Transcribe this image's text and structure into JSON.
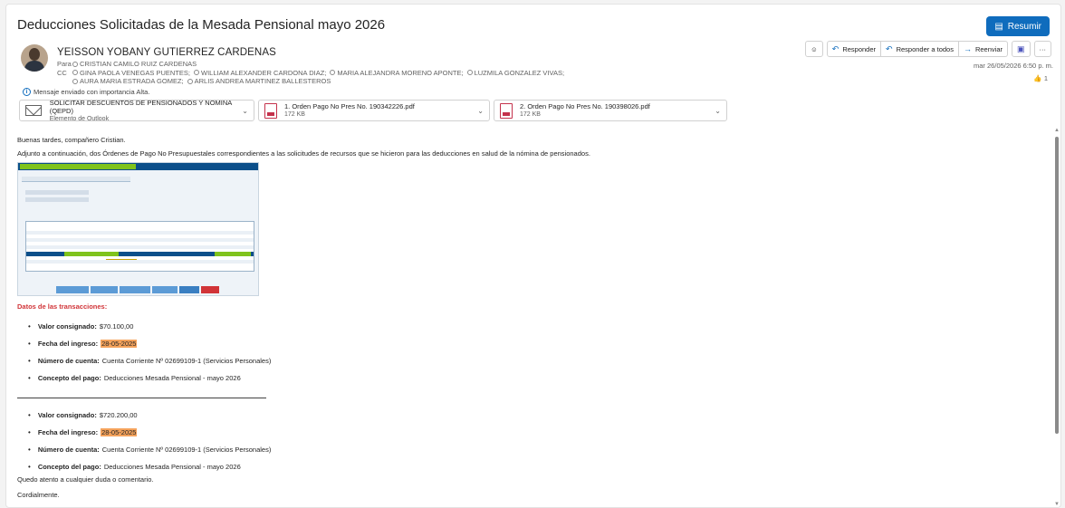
{
  "header": {
    "subject": "Deducciones Solicitadas de la Mesada Pensional mayo 2026",
    "summarize_label": "Resumir"
  },
  "message": {
    "sender": "YEISSON YOBANY GUTIERREZ CARDENAS",
    "to_label": "Para",
    "to": [
      "CRISTIAN CAMILO RUIZ CARDENAS"
    ],
    "cc_label": "CC",
    "cc_line1": [
      "GINA PAOLA VENEGAS PUENTES;",
      "WILLIAM ALEXANDER CARDONA DIAZ;",
      "MARIA ALEJANDRA MORENO APONTE;",
      "LUZMILA GONZALEZ VIVAS;"
    ],
    "cc_line2": [
      "AURA MARIA ESTRADA GOMEZ;",
      "ARLIS ANDREA MARTINEZ BALLESTEROS"
    ],
    "importance": "Mensaje enviado con importancia Alta.",
    "date": "mar 26/05/2026 6:50 p. m.",
    "likes": "1"
  },
  "actions": {
    "reply": "Responder",
    "reply_all": "Responder a todos",
    "forward": "Reenviar",
    "more": "···"
  },
  "attachments": [
    {
      "name": "SOLICITAR DESCUENTOS  DE  PENSIONADOS Y NOMINA  (QEPD)",
      "sub": "Elemento de Outlook"
    },
    {
      "name": "1. Orden Pago No Pres No. 190342226.pdf",
      "sub": "172 KB"
    },
    {
      "name": "2. Orden Pago No Pres No. 190398026.pdf",
      "sub": "172 KB"
    }
  ],
  "body": {
    "greeting": "Buenas tardes, compañero Cristian.",
    "intro": "Adjunto a continuación, dos Órdenes de Pago No Presupuestales correspondientes a las solicitudes de recursos que se hicieron para las deducciones en salud de la nómina de pensionados.",
    "data_heading": "Datos de las transacciones:",
    "tx1": {
      "amount_label": "Valor consignado:",
      "amount": "$70.100,00",
      "date_label": "Fecha del ingreso:",
      "date": "28-05-2025",
      "account_label": "Número de cuenta:",
      "account": "Cuenta Corriente Nº 02699109-1 (Servicios Personales)",
      "concept_label": "Concepto del pago:",
      "concept": "Deducciones Mesada Pensional - mayo 2026"
    },
    "tx2": {
      "amount_label": "Valor consignado:",
      "amount": "$720.200,00",
      "date_label": "Fecha del ingreso:",
      "date": "28-05-2025",
      "account_label": "Número de cuenta:",
      "account": "Cuenta Corriente Nº 02699109-1 (Servicios Personales)",
      "concept_label": "Concepto del pago:",
      "concept": "Deducciones Mesada Pensional - mayo 2026"
    },
    "closing": "Quedo atento a cualquier duda o comentario.",
    "signoff": "Cordialmente."
  }
}
